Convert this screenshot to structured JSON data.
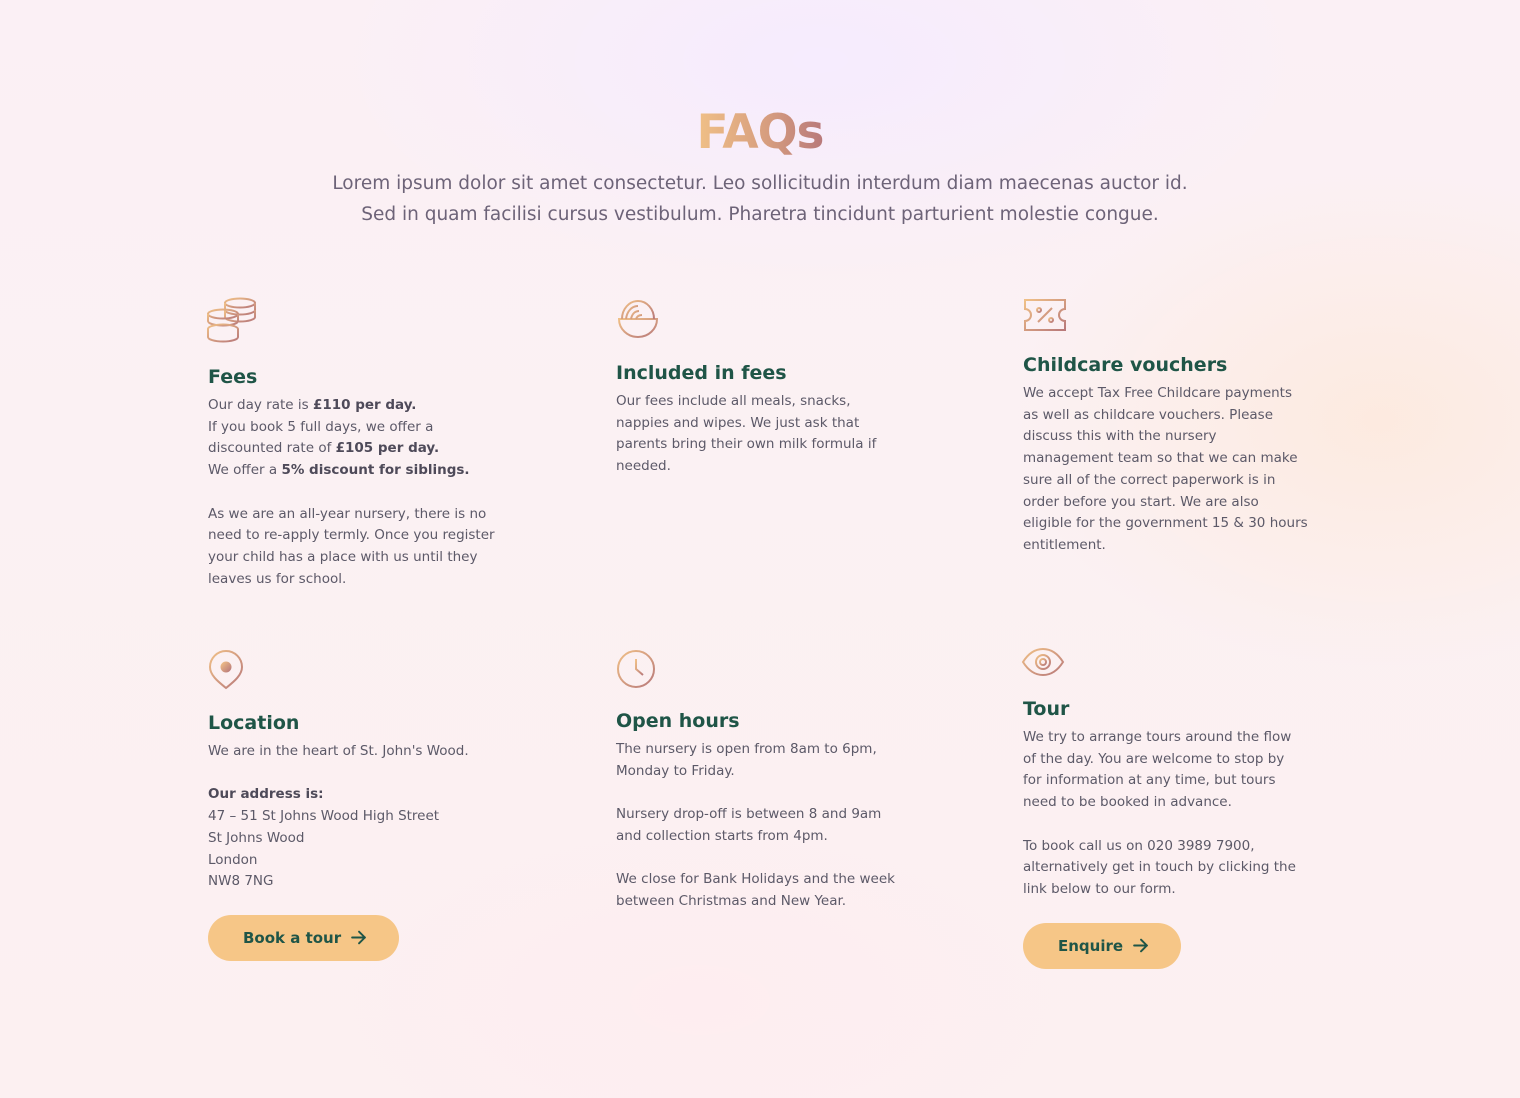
{
  "header": {
    "title": "FAQs",
    "intro_line1": "Lorem ipsum dolor sit amet consectetur. Leo sollicitudin interdum diam maecenas auctor id.",
    "intro_line2": "Sed in quam facilisi cursus vestibulum. Pharetra tincidunt parturient molestie congue."
  },
  "colors": {
    "heading_green": "#1f5547",
    "body_text": "#5c5968",
    "button_bg": "#f6c687",
    "icon_gradient_start": "#f0c087",
    "icon_gradient_end": "#b8797a"
  },
  "cards": {
    "fees": {
      "icon": "coins-icon",
      "title": "Fees",
      "l1_pre": "Our day rate is ",
      "l1_bold": "£110 per day.",
      "l2": "If you book 5 full days, we offer a",
      "l3_pre": "discounted rate of ",
      "l3_bold": "£105 per day.",
      "l4_pre": "We offer a ",
      "l4_bold": "5% discount for siblings.",
      "p2": "As we are an all-year nursery, there is no need to re-apply termly. Once you register your child has a place with us until they leaves us for school."
    },
    "included": {
      "icon": "bowl-icon",
      "title": "Included in fees",
      "p1": "Our fees include all meals, snacks, nappies and wipes. We just ask that parents bring their own milk formula if needed."
    },
    "vouchers": {
      "icon": "ticket-percent-icon",
      "title": "Childcare vouchers",
      "p1": "We accept Tax Free Childcare payments as well as childcare vouchers. Please discuss this with the nursery management team so that we can make sure all of the correct paperwork is in order before you start. We are also eligible for the government 15 & 30 hours entitlement."
    },
    "location": {
      "icon": "map-pin-icon",
      "title": "Location",
      "p1": "We are in the heart of St. John's Wood.",
      "address_label": "Our address is:",
      "address": [
        "47 – 51 St Johns Wood High Street",
        "St Johns Wood",
        "London",
        "NW8 7NG"
      ],
      "button": "Book a tour"
    },
    "hours": {
      "icon": "clock-icon",
      "title": "Open hours",
      "p1": "The nursery is open from 8am to 6pm, Monday to Friday.",
      "p2": "Nursery drop-off is between 8 and 9am and collection starts from 4pm.",
      "p3": "We close for Bank Holidays and the week between Christmas and New Year."
    },
    "tour": {
      "icon": "eye-icon",
      "title": "Tour",
      "p1": "We try to arrange tours around the flow of the day. You are welcome to stop by for information at any time, but tours need to be booked in advance.",
      "p2": "To book call us on 020 3989 7900, alternatively get in touch by clicking the link below to our form.",
      "button": "Enquire"
    }
  }
}
